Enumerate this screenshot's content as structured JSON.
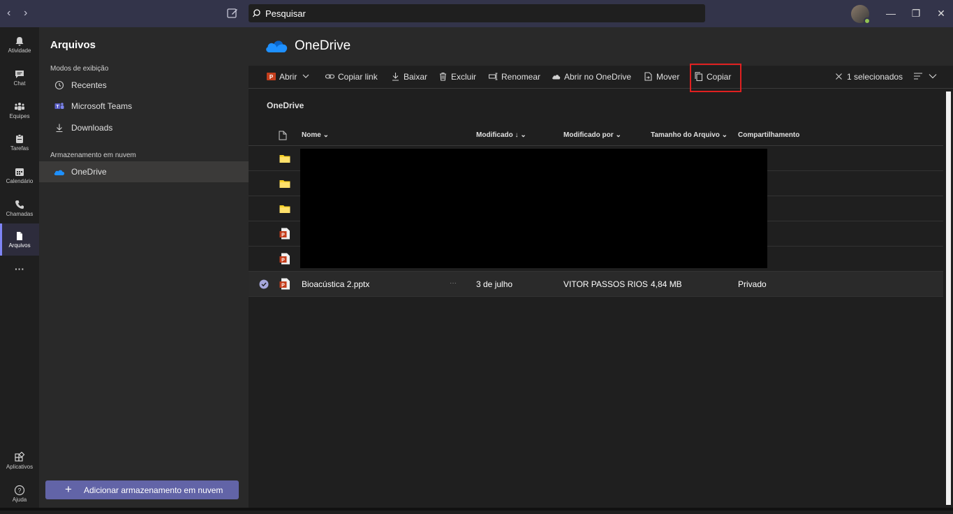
{
  "titlebar": {
    "back_icon": "chevron-left-icon",
    "forward_icon": "chevron-right-icon",
    "search_placeholder": "Pesquisar",
    "minimize": "—",
    "restore": "❐",
    "close": "✕"
  },
  "rail": {
    "items": [
      {
        "label": "Atividade",
        "icon": "bell-icon"
      },
      {
        "label": "Chat",
        "icon": "chat-icon"
      },
      {
        "label": "Equipes",
        "icon": "teams-icon"
      },
      {
        "label": "Tarefas",
        "icon": "tasks-icon"
      },
      {
        "label": "Calendário",
        "icon": "calendar-icon"
      },
      {
        "label": "Chamadas",
        "icon": "phone-icon"
      },
      {
        "label": "Arquivos",
        "icon": "file-icon"
      }
    ],
    "more": "···",
    "apps_label": "Aplicativos",
    "help_label": "Ajuda"
  },
  "sidepanel": {
    "title": "Arquivos",
    "views_header": "Modos de exibição",
    "views": [
      {
        "label": "Recentes",
        "icon": "clock-icon"
      },
      {
        "label": "Microsoft Teams",
        "icon": "teams-logo-icon"
      },
      {
        "label": "Downloads",
        "icon": "download-icon"
      }
    ],
    "cloud_header": "Armazenamento em nuvem",
    "cloud_items": [
      {
        "label": "OneDrive",
        "icon": "onedrive-icon"
      }
    ],
    "add_button": "Adicionar armazenamento em nuvem"
  },
  "main": {
    "title": "OneDrive",
    "commands": {
      "open": "Abrir",
      "copy_link": "Copiar link",
      "download": "Baixar",
      "delete": "Excluir",
      "rename": "Renomear",
      "open_onedrive": "Abrir no OneDrive",
      "move": "Mover",
      "copy": "Copiar",
      "selected": "1 selecionados"
    },
    "breadcrumb": "OneDrive",
    "columns": {
      "name": "Nome",
      "modified": "Modificado",
      "modified_by": "Modificado por",
      "size": "Tamanho do Arquivo",
      "sharing": "Compartilhamento"
    },
    "rows": [
      {
        "type": "folder"
      },
      {
        "type": "folder"
      },
      {
        "type": "folder"
      },
      {
        "type": "pptx"
      },
      {
        "type": "pptx"
      }
    ],
    "selected_row": {
      "name": "Bioacústica 2.pptx",
      "more": "···",
      "modified": "3 de julho",
      "modified_by": "VITOR PASSOS RIOS",
      "size": "4,84 MB",
      "sharing": "Privado"
    }
  },
  "colors": {
    "accent": "#6264a7",
    "folder": "#f8d22a",
    "ppt": "#c43e1c",
    "onedrive": "#0f78d4",
    "highlight": "#e02020"
  }
}
